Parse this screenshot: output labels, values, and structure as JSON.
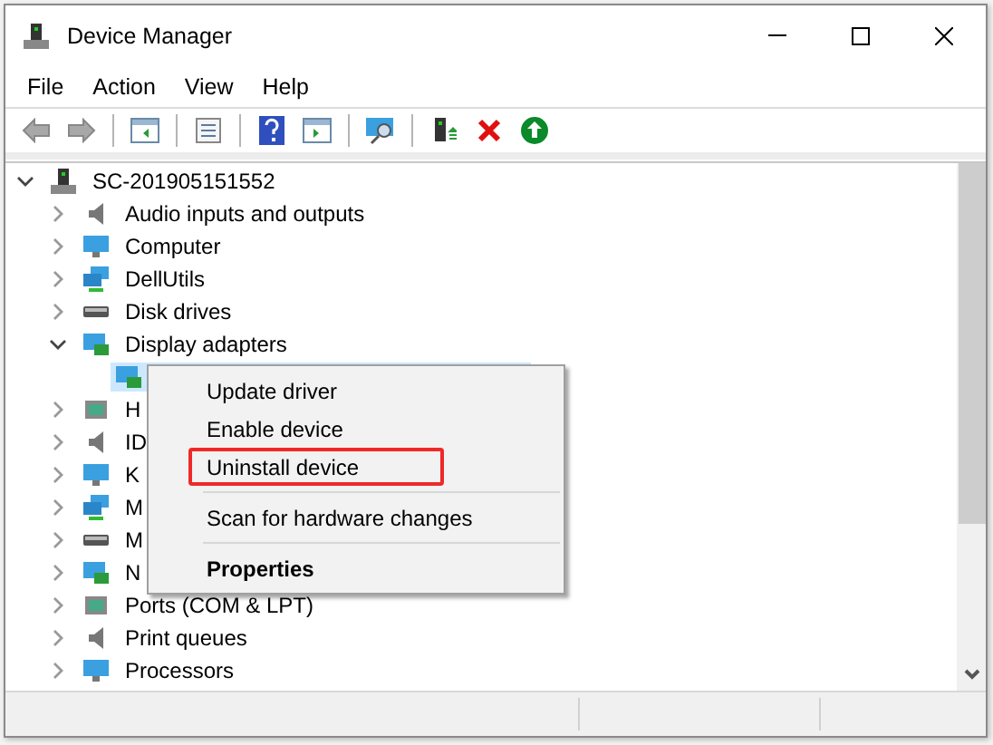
{
  "window": {
    "title": "Device Manager"
  },
  "menu_bar": [
    "File",
    "Action",
    "View",
    "Help"
  ],
  "tree": {
    "label": "SC-201905151552",
    "expanded": true,
    "children": [
      {
        "label": "Audio inputs and outputs",
        "expanded": false
      },
      {
        "label": "Computer",
        "expanded": false
      },
      {
        "label": "DellUtils",
        "expanded": false
      },
      {
        "label": "Disk drives",
        "expanded": false
      },
      {
        "label": "Display adapters",
        "expanded": true,
        "children": [
          {
            "selected": true
          }
        ]
      },
      {
        "label": "H",
        "expanded": false
      },
      {
        "label": "ID",
        "expanded": false
      },
      {
        "label": "K",
        "expanded": false
      },
      {
        "label": "M",
        "expanded": false
      },
      {
        "label": "M",
        "expanded": false
      },
      {
        "label": "N",
        "expanded": false
      },
      {
        "label": "Ports (COM & LPT)",
        "expanded": false
      },
      {
        "label": "Print queues",
        "expanded": false
      },
      {
        "label": "Processors",
        "expanded": false
      }
    ]
  },
  "context_menu": [
    {
      "label": "Update driver",
      "separator_before": false,
      "default": false,
      "annotated": false
    },
    {
      "label": "Enable device",
      "separator_before": false,
      "default": false,
      "annotated": false
    },
    {
      "label": "Uninstall device",
      "separator_before": false,
      "default": false,
      "annotated": true
    },
    {
      "label": "Scan for hardware changes",
      "separator_before": true,
      "default": false,
      "annotated": false
    },
    {
      "label": "Properties",
      "separator_before": true,
      "default": true,
      "annotated": false
    }
  ]
}
